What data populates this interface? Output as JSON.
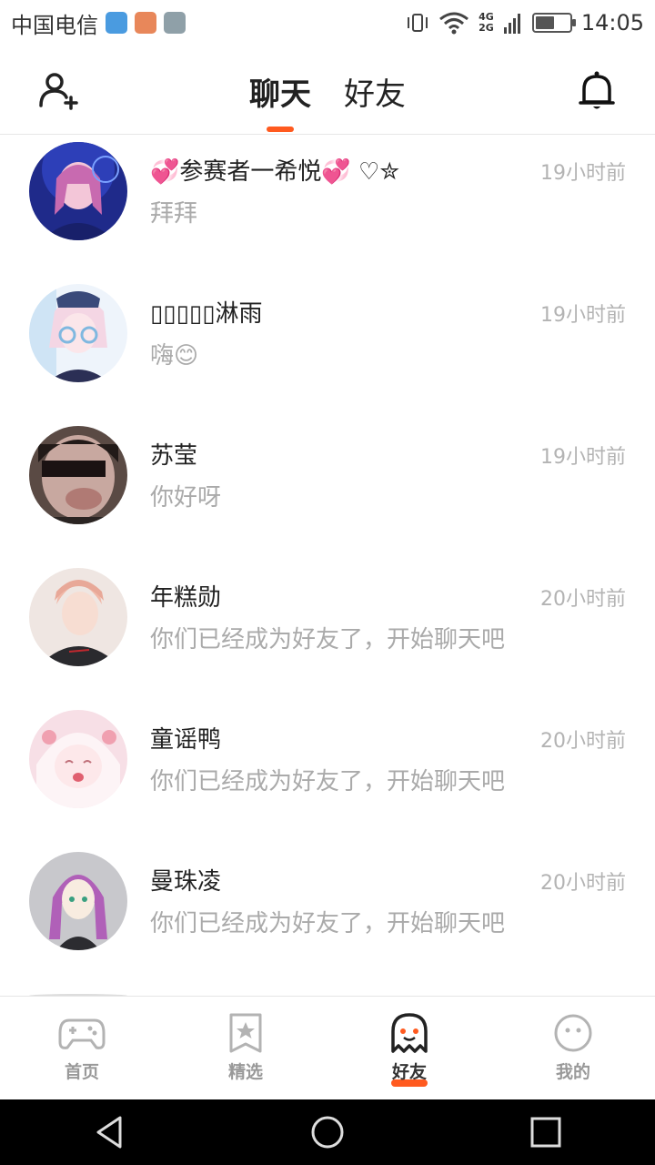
{
  "status_bar": {
    "carrier": "中国电信",
    "network_top": "4G",
    "network_bottom": "2G",
    "time": "14:05",
    "battery_level": 0.55
  },
  "header": {
    "tabs": [
      {
        "label": "聊天",
        "active": true
      },
      {
        "label": "好友",
        "active": false
      }
    ]
  },
  "colors": {
    "accent": "#ff5a1f",
    "time_text": "#b3b3b3",
    "message_text": "#aaaaaa"
  },
  "chats": [
    {
      "name": "💞参赛者一希悦💞 ♡✮",
      "time": "19小时前",
      "message": "拜拜"
    },
    {
      "name": "▯▯▯▯▯淋雨",
      "time": "19小时前",
      "message": "嗨😊"
    },
    {
      "name": "苏莹",
      "time": "19小时前",
      "message": "你好呀"
    },
    {
      "name": "年糕勋",
      "time": "20小时前",
      "message": "你们已经成为好友了，开始聊天吧"
    },
    {
      "name": "童谣鸭",
      "time": "20小时前",
      "message": "你们已经成为好友了，开始聊天吧"
    },
    {
      "name": "曼珠凌",
      "time": "20小时前",
      "message": "你们已经成为好友了，开始聊天吧"
    }
  ],
  "bottom_nav": [
    {
      "label": "首页",
      "icon": "gamepad-icon",
      "active": false
    },
    {
      "label": "精选",
      "icon": "star-bookmark-icon",
      "active": false
    },
    {
      "label": "好友",
      "icon": "ghost-icon",
      "active": true
    },
    {
      "label": "我的",
      "icon": "face-icon",
      "active": false
    }
  ]
}
